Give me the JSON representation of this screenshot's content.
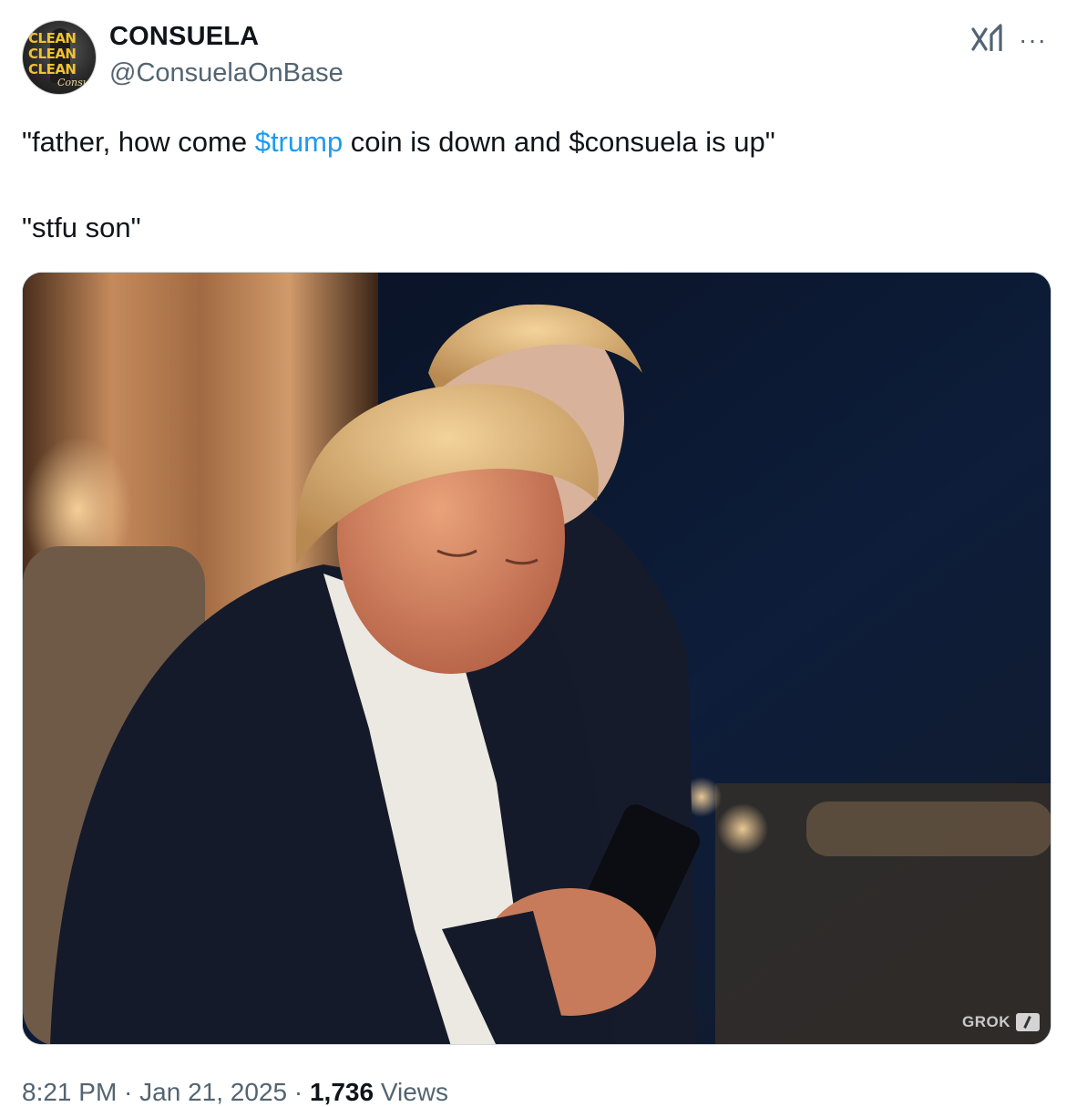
{
  "author": {
    "name": "CONSUELA",
    "handle": "@ConsuelaOnBase",
    "avatar_text": [
      "CLEAN",
      "CLEAN",
      "CLEAN"
    ],
    "avatar_signature": "Consuela"
  },
  "header_icons": [
    "grok-icon",
    "more-icon"
  ],
  "more_label": "···",
  "tweet": {
    "line1_before": "\"father, how come ",
    "cashtag": "$trump",
    "line1_after": " coin is down and $consuela is up\"",
    "line2": "\"stfu son\""
  },
  "media": {
    "watermark": "GROK"
  },
  "meta": {
    "time": "8:21 PM",
    "sep1": " · ",
    "date": "Jan 21, 2025",
    "sep2": " · ",
    "views_count": "1,736",
    "views_label": " Views"
  },
  "colors": {
    "link": "#1d9bf0",
    "secondary_text": "#536471",
    "primary_text": "#0f1419"
  }
}
